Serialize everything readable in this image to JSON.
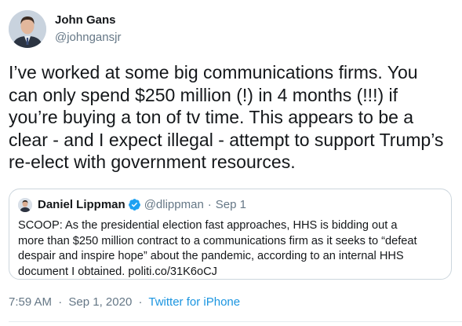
{
  "author": {
    "name": "John Gans",
    "handle": "@johngansjr",
    "avatar_icon": "profile-photo"
  },
  "tweet": {
    "text": "I’ve worked at some big communications firms. You\ncan only spend $250 million (!) in 4 months (!!!) if\nyou’re buying a ton of tv time. This appears to be a\nclear - and I expect illegal - attempt to support Trump’s\nre-elect with government resources."
  },
  "quoted_tweet": {
    "author_name": "Daniel Lippman",
    "verified_icon": "verified-badge-icon",
    "handle": "@dlippman",
    "separator": "·",
    "date": "Sep 1",
    "text": "SCOOP: As the presidential election fast approaches, HHS is bidding out a\nmore than $250 million contract to a communications firm as it seeks to “defeat\ndespair and inspire hope” about the pandemic, according to an internal HHS\ndocument I obtained. politi.co/31K6oCJ"
  },
  "meta": {
    "time": "7:59 AM",
    "separator": "·",
    "date": "Sep 1, 2020",
    "separator2": "·",
    "source": "Twitter for iPhone"
  },
  "colors": {
    "text": "#14171a",
    "secondary": "#657786",
    "link": "#1b95e0",
    "border": "#ccd6dd"
  }
}
